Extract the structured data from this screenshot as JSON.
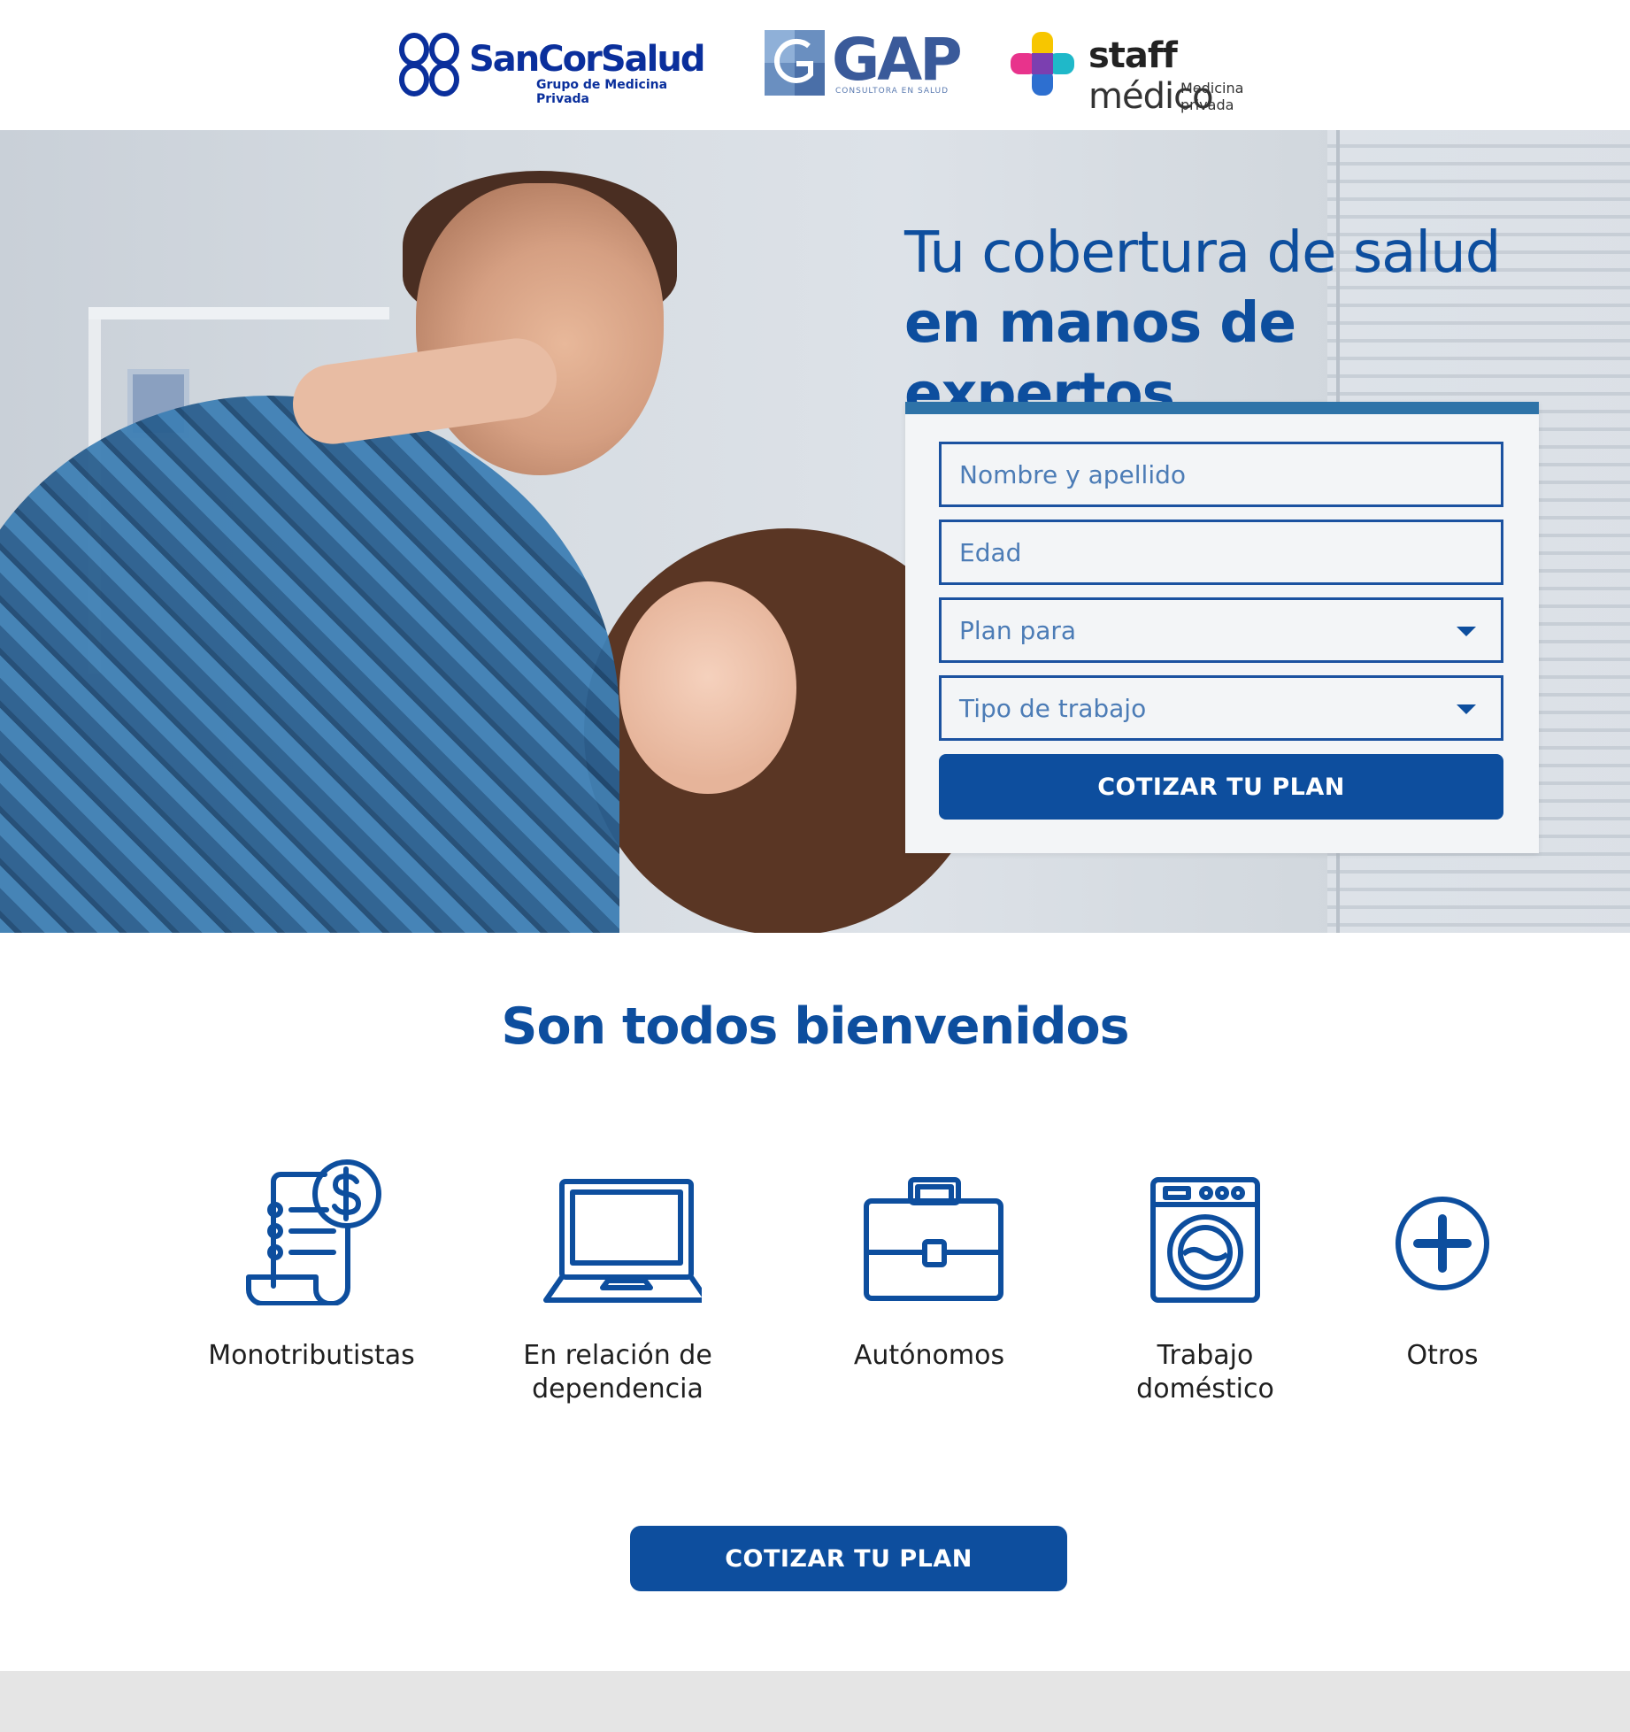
{
  "header": {
    "logos": [
      {
        "name": "SanCorSalud",
        "subtitle": "Grupo de Medicina Privada"
      },
      {
        "name": "GAP",
        "subtitle": "CONSULTORA EN SALUD"
      },
      {
        "name_bold": "staff",
        "name_light": "médico",
        "subtitle": "Medicina privada"
      }
    ]
  },
  "hero": {
    "title_line1": "Tu cobertura de salud",
    "title_line2": "en manos de expertos"
  },
  "form": {
    "name_placeholder": "Nombre y apellido",
    "age_placeholder": "Edad",
    "plan_for_selected": "Plan para",
    "work_type_selected": "Tipo de trabajo",
    "submit_label": "COTIZAR TU PLAN"
  },
  "welcome": {
    "title_regular": "Son todos",
    "title_bold": "bienvenidos",
    "categories": [
      {
        "label": "Monotributistas",
        "icon": "invoice-dollar-icon"
      },
      {
        "label": "En relación de\ndependencia",
        "icon": "laptop-icon"
      },
      {
        "label": "Autónomos",
        "icon": "briefcase-icon"
      },
      {
        "label": "Trabajo\ndoméstico",
        "icon": "washing-machine-icon"
      },
      {
        "label": "Otros",
        "icon": "plus-circle-icon"
      }
    ],
    "cta_label": "COTIZAR TU PLAN"
  },
  "colors": {
    "brand_blue": "#0d4e9e",
    "accent_bar": "#2e73a8",
    "footer_gray": "#e5e5e5"
  }
}
